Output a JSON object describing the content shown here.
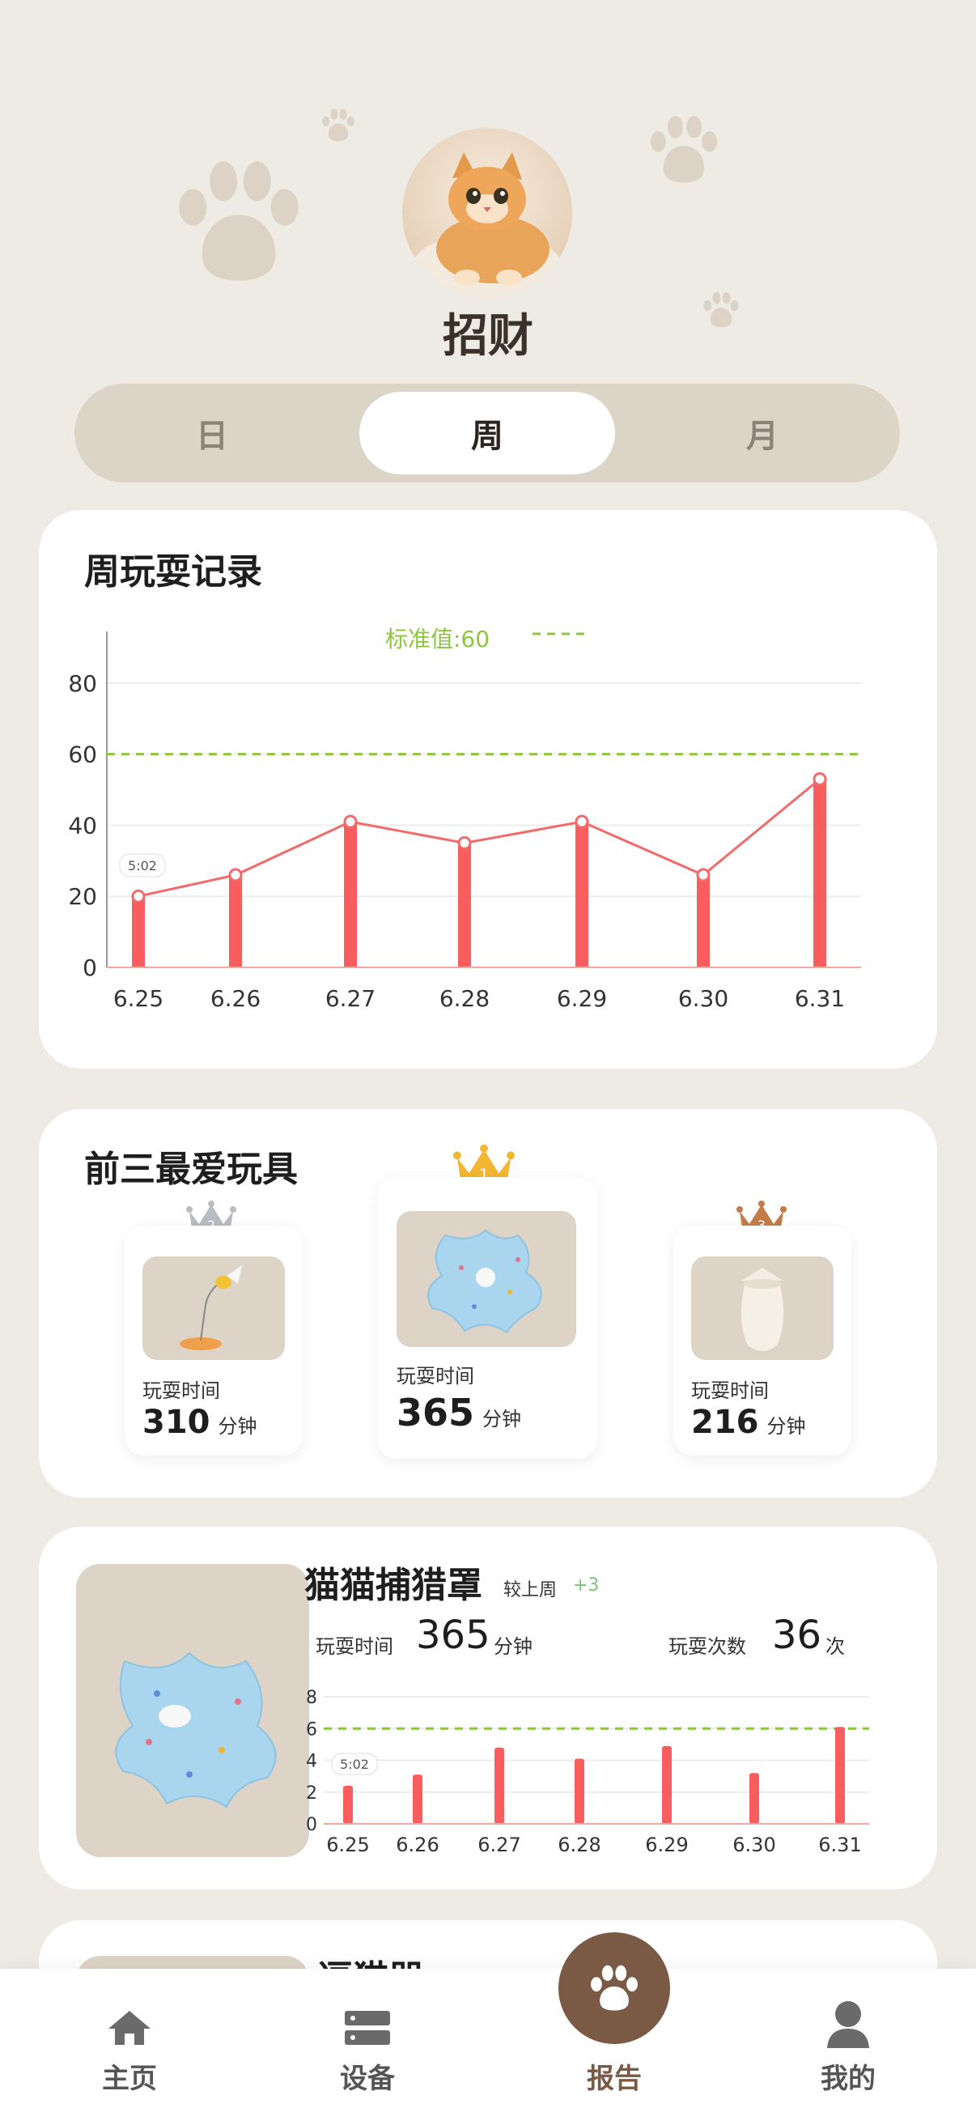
{
  "pet": {
    "name": "招财",
    "avatar_icon": "cat-photo"
  },
  "period_tabs": [
    {
      "label": "日",
      "active": false
    },
    {
      "label": "周",
      "active": true
    },
    {
      "label": "月",
      "active": false
    }
  ],
  "weekly_chart": {
    "title": "周玩耍记录",
    "standard_label": "标准值:60",
    "tooltip": "5:02",
    "chart_data": {
      "type": "bar",
      "categories": [
        "6.25",
        "6.26",
        "6.27",
        "6.28",
        "6.29",
        "6.30",
        "6.31"
      ],
      "values": [
        20,
        26,
        41,
        35,
        41,
        26,
        53
      ],
      "line_overlay": true,
      "reference_line": 60,
      "ylim": [
        0,
        90
      ],
      "yticks": [
        0,
        20,
        40,
        60,
        80
      ],
      "colors": {
        "bar": "#f95d5d",
        "line": "#f26a6a",
        "reference": "#8cc63f"
      }
    }
  },
  "top_toys": {
    "title": "前三最爱玩具",
    "items": [
      {
        "rank": "2",
        "play_time_label": "玩耍时间",
        "value": "310",
        "unit": "分钟",
        "crown_color": "#b8bcc2",
        "icon": "bee-toy"
      },
      {
        "rank": "1",
        "play_time_label": "玩耍时间",
        "value": "365",
        "unit": "分钟",
        "crown_color": "#f2b632",
        "icon": "mat-toy"
      },
      {
        "rank": "3",
        "play_time_label": "玩耍时间",
        "value": "216",
        "unit": "分钟",
        "crown_color": "#c47b4a",
        "icon": "cup-toy"
      }
    ]
  },
  "toy_detail": {
    "name": "猫猫捕猎罩",
    "compare_label": "较上周",
    "compare_value": "+3",
    "play_time_label": "玩耍时间",
    "play_time_value": "365",
    "play_time_unit": "分钟",
    "play_count_label": "玩耍次数",
    "play_count_value": "36",
    "play_count_unit": "次",
    "tooltip": "5:02",
    "chart_data": {
      "type": "bar",
      "categories": [
        "6.25",
        "6.26",
        "6.27",
        "6.28",
        "6.29",
        "6.30",
        "6.31"
      ],
      "values": [
        2.4,
        3.1,
        4.8,
        4.1,
        4.9,
        3.2,
        6.1
      ],
      "reference_line": 6,
      "ylim": [
        0,
        8
      ],
      "yticks": [
        0,
        2,
        4,
        6,
        8
      ],
      "colors": {
        "bar": "#f95d5d",
        "reference": "#8cc63f"
      }
    }
  },
  "next_card": {
    "name_partial": "逗猫器"
  },
  "bottom_nav": [
    {
      "label": "主页",
      "icon": "home-icon",
      "active": false
    },
    {
      "label": "设备",
      "icon": "device-icon",
      "active": false
    },
    {
      "label": "报告",
      "icon": "paw-icon",
      "active": true
    },
    {
      "label": "我的",
      "icon": "user-icon",
      "active": false
    }
  ]
}
